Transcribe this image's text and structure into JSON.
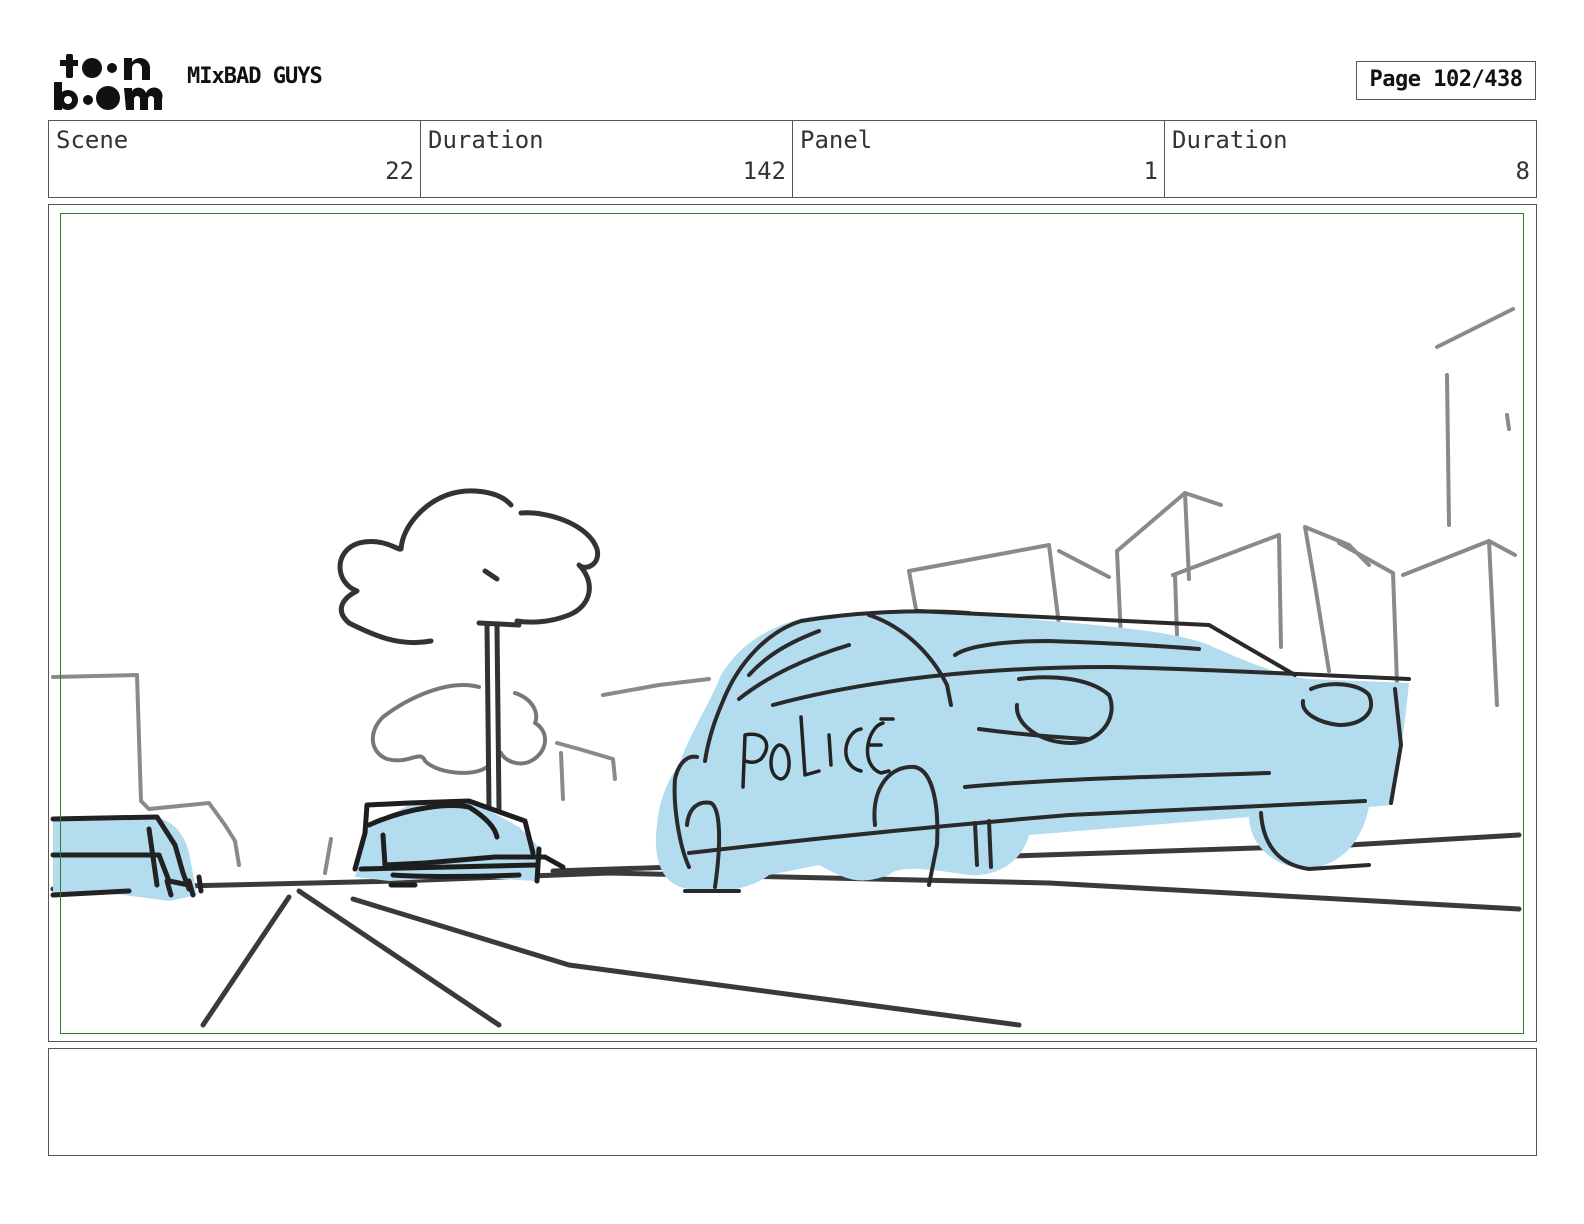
{
  "header": {
    "logo": {
      "top_word": "toon",
      "bottom_word": "boom"
    },
    "project_title": "MIxBAD GUYS",
    "page_label": "Page 102/438"
  },
  "info": [
    {
      "label": "Scene",
      "value": "22"
    },
    {
      "label": "Duration",
      "value": "142"
    },
    {
      "label": "Panel",
      "value": "1"
    },
    {
      "label": "Duration",
      "value": "8"
    }
  ],
  "panel": {
    "sketch_text": "POLICE",
    "colors": {
      "fill": "#b3dcef",
      "ink": "#2a2a2a",
      "safe_area": "#2e7d32"
    }
  },
  "notes": {
    "text": ""
  }
}
